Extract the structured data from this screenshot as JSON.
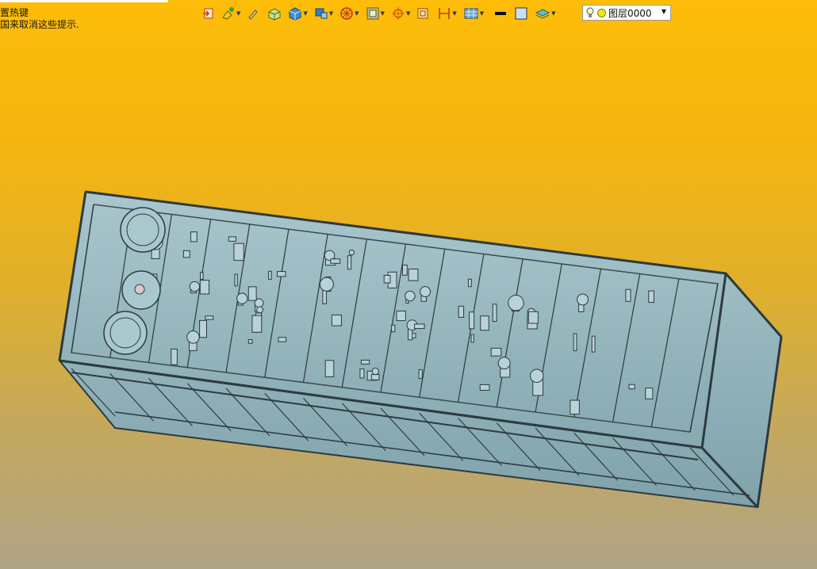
{
  "hint": {
    "line1": "置热键",
    "line2": "国来取消这些提示."
  },
  "toolbar": {
    "icons": [
      "exit-icon",
      "paint-icon",
      "pen-icon",
      "cube-yellow-icon",
      "cube-blue-icon",
      "cube-dropdown-icon",
      "wheel-icon",
      "display-mode-icon",
      "snap-icon",
      "frame-icon",
      "dimension-icon",
      "grid-icon",
      "line-color-icon",
      "fill-color-icon",
      "layer-stack-icon"
    ],
    "line_color": "#111111",
    "fill_color": "#c8dff5"
  },
  "layer": {
    "name": "图层0000",
    "dot_color": "#f2e61a"
  },
  "viewport": {
    "background_top": "#fdbd08",
    "background_bottom": "#b0a486",
    "model_color": "#8fb3bd",
    "model_edge": "#2c3a3e"
  }
}
